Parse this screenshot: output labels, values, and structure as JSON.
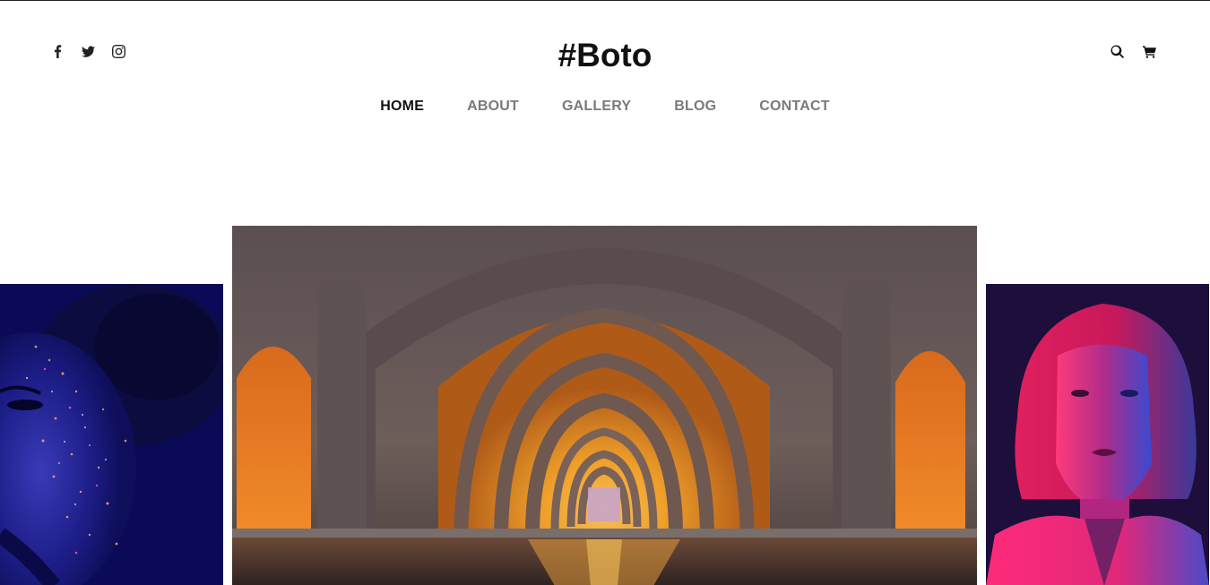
{
  "header": {
    "logo": "#Boto",
    "social_icons": [
      "facebook-icon",
      "twitter-icon",
      "instagram-icon"
    ],
    "utility_icons": [
      "search-icon",
      "cart-icon"
    ]
  },
  "nav": {
    "items": [
      {
        "label": "HOME",
        "active": true
      },
      {
        "label": "ABOUT",
        "active": false
      },
      {
        "label": "GALLERY",
        "active": false
      },
      {
        "label": "BLOG",
        "active": false
      },
      {
        "label": "CONTACT",
        "active": false
      }
    ],
    "active_underline_color": "#7dbb3a"
  },
  "slider": {
    "slides": [
      {
        "name": "slide-portrait-glitter",
        "tint": "#14147a"
      },
      {
        "name": "slide-arches-hall",
        "tint": "#e08a20"
      },
      {
        "name": "slide-portrait-neon",
        "tint": "#e0206a"
      }
    ]
  }
}
